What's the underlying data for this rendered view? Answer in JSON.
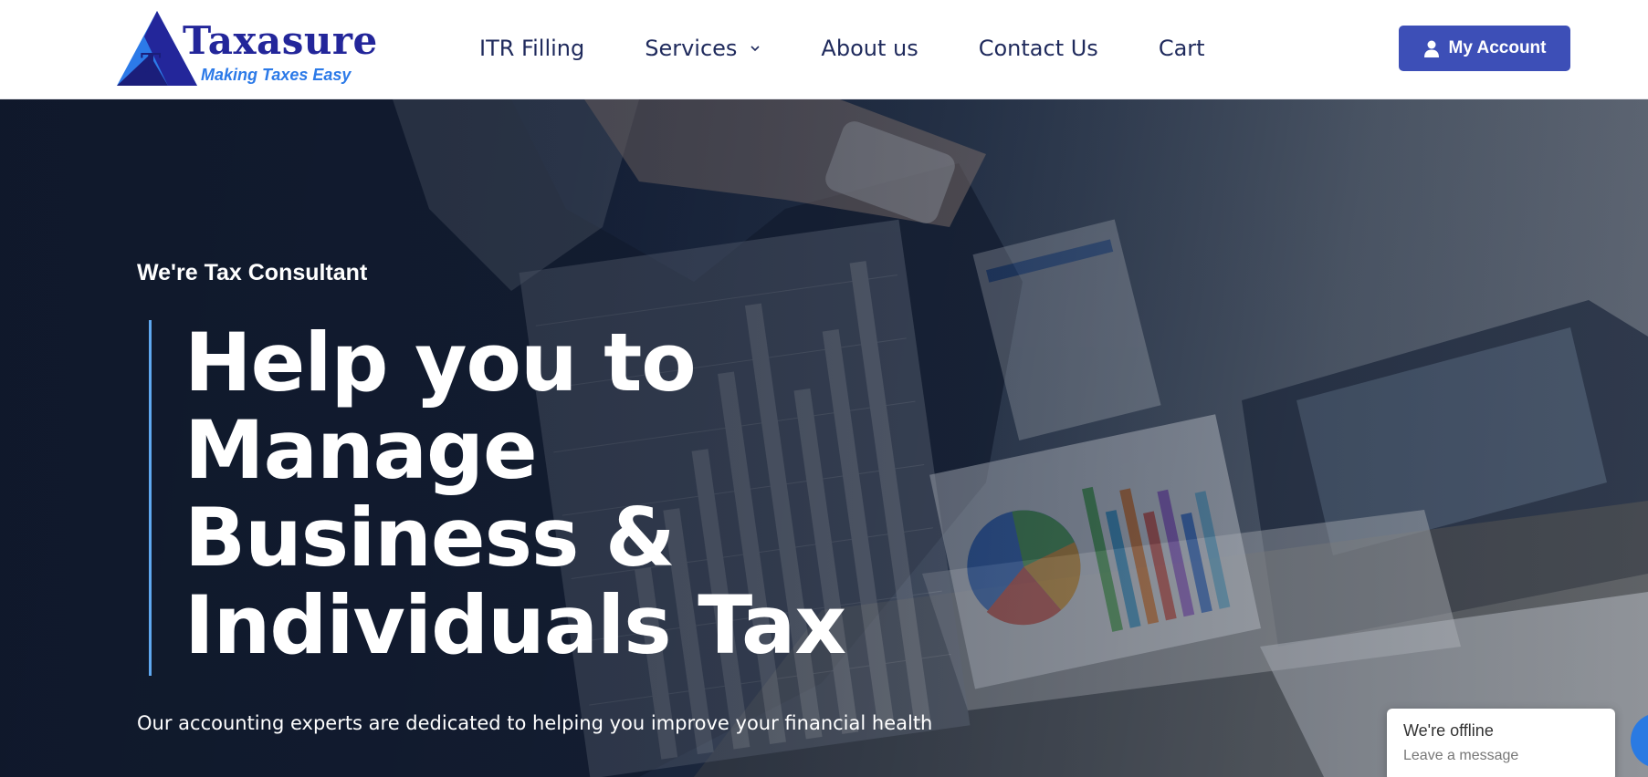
{
  "brand": {
    "logo_letter": "T",
    "name": "Taxasure",
    "tagline": "Making Taxes Easy",
    "color_primary": "#23269a",
    "color_secondary": "#2c7ae8"
  },
  "nav": {
    "items": [
      {
        "label": "ITR Filling",
        "icon": ""
      },
      {
        "label": "Services",
        "icon": "chevron-down-icon"
      },
      {
        "label": "About us",
        "icon": ""
      },
      {
        "label": "Contact Us",
        "icon": ""
      },
      {
        "label": "Cart",
        "icon": ""
      }
    ],
    "color": "#1f2a5c"
  },
  "account_button": {
    "label": "My Account",
    "icon": "user-icon",
    "color": "#3d4fb7"
  },
  "hero": {
    "eyebrow": "We're Tax Consultant",
    "headline_lines": [
      "Help you to",
      "Manage",
      "Business &",
      "Individuals Tax"
    ],
    "subtext": "Our accounting experts are dedicated to helping you improve your financial health",
    "accent_color": "#5fa8f0"
  },
  "chat_widget": {
    "status": "We're offline",
    "action": "Leave a message",
    "icon": "chat-icon",
    "color": "#2a7ae2"
  }
}
